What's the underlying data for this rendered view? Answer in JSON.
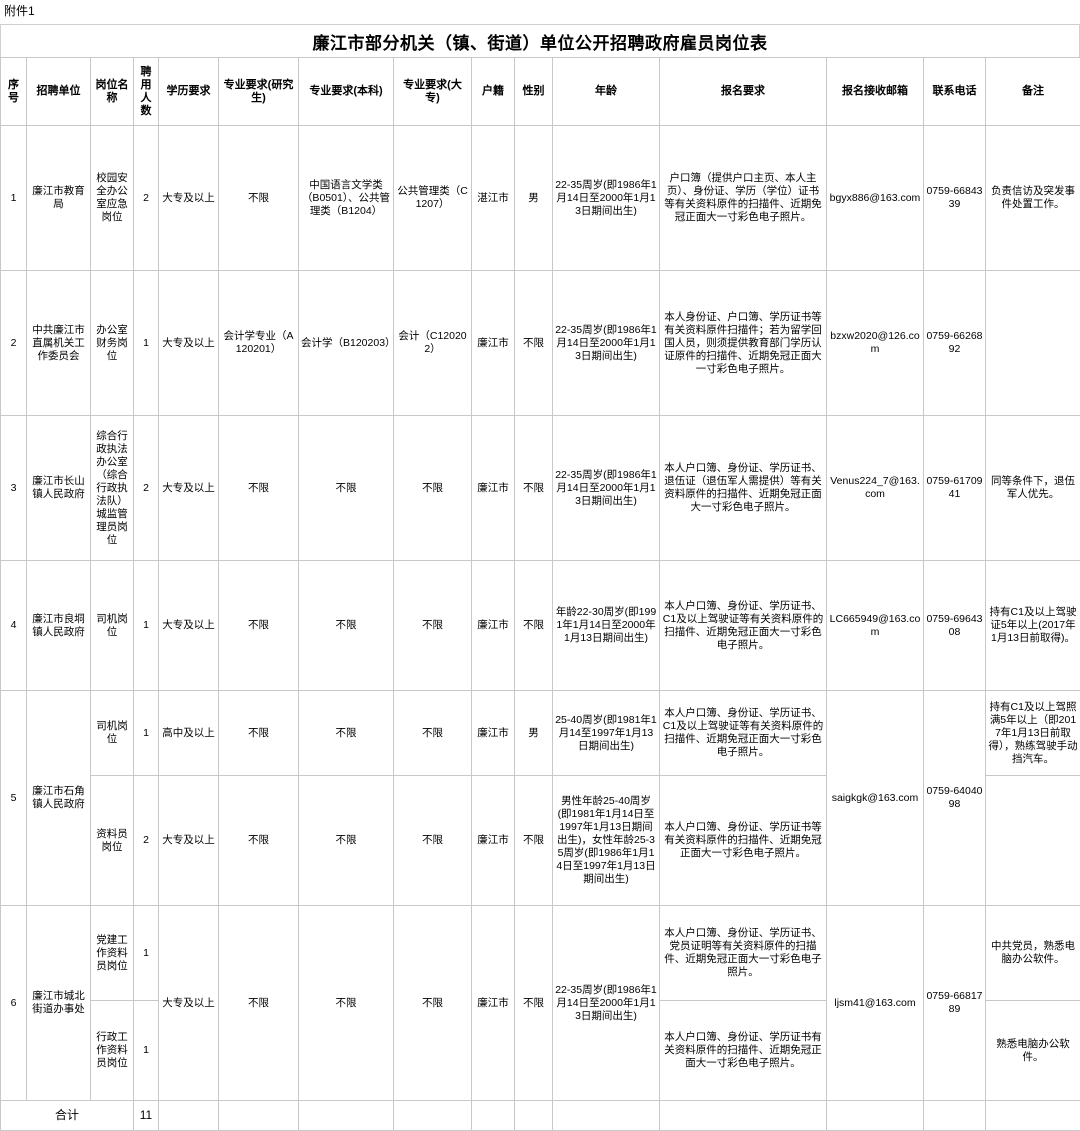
{
  "attachment_label": "附件1",
  "title": "廉江市部分机关（镇、街道）单位公开招聘政府雇员岗位表",
  "columns": {
    "idx": "序号",
    "unit": "招聘单位",
    "post": "岗位名称",
    "num": "聘用人数",
    "edu": "学历要求",
    "major_grad": "专业要求(研究生)",
    "major_bach": "专业要求(本科)",
    "major_assoc": "专业要求(大专)",
    "huji": "户籍",
    "sex": "性别",
    "age": "年龄",
    "req": "报名要求",
    "mail": "报名接收邮箱",
    "tel": "联系电话",
    "note": "备注"
  },
  "rows": [
    {
      "idx": "1",
      "unit": "廉江市教育局",
      "post": "校园安全办公室应急岗位",
      "num": "2",
      "edu": "大专及以上",
      "major_grad": "不限",
      "major_bach": "中国语言文学类（B0501）、公共管理类（B1204）",
      "major_assoc": "公共管理类（C1207）",
      "huji": "湛江市",
      "sex": "男",
      "age": "22-35周岁(即1986年1月14日至2000年1月13日期间出生)",
      "req": "户口簿（提供户口主页、本人主页）、身份证、学历（学位）证书等有关资料原件的扫描件、近期免冠正面大一寸彩色电子照片。",
      "mail": "bgyx886@163.com",
      "tel": "0759-6684339",
      "note": "负责信访及突发事件处置工作。"
    },
    {
      "idx": "2",
      "unit": "中共廉江市直属机关工作委员会",
      "post": "办公室财务岗位",
      "num": "1",
      "edu": "大专及以上",
      "major_grad": "会计学专业（A120201）",
      "major_bach": "会计学（B120203）",
      "major_assoc": "会计（C120202）",
      "huji": "廉江市",
      "sex": "不限",
      "age": "22-35周岁(即1986年1月14日至2000年1月13日期间出生)",
      "req": "本人身份证、户口簿、学历证书等有关资料原件扫描件；若为留学回国人员，则须提供教育部门学历认证原件的扫描件、近期免冠正面大一寸彩色电子照片。",
      "mail": "bzxw2020@126.com",
      "tel": "0759-6626892",
      "note": ""
    },
    {
      "idx": "3",
      "unit": "廉江市长山镇人民政府",
      "post": "综合行政执法办公室（综合行政执法队）城监管理员岗位",
      "num": "2",
      "edu": "大专及以上",
      "major_grad": "不限",
      "major_bach": "不限",
      "major_assoc": "不限",
      "huji": "廉江市",
      "sex": "不限",
      "age": "22-35周岁(即1986年1月14日至2000年1月13日期间出生)",
      "req": "本人户口簿、身份证、学历证书、退伍证（退伍军人需提供）等有关资料原件的扫描件、近期免冠正面大一寸彩色电子照片。",
      "mail": "Venus224_7@163.com",
      "tel": "0759-6170941",
      "note": "同等条件下，退伍军人优先。"
    },
    {
      "idx": "4",
      "unit": "廉江市良垌镇人民政府",
      "post": "司机岗位",
      "num": "1",
      "edu": "大专及以上",
      "major_grad": "不限",
      "major_bach": "不限",
      "major_assoc": "不限",
      "huji": "廉江市",
      "sex": "不限",
      "age": "年龄22-30周岁(即1991年1月14日至2000年1月13日期间出生)",
      "req": "本人户口簿、身份证、学历证书、C1及以上驾驶证等有关资料原件的扫描件、近期免冠正面大一寸彩色电子照片。",
      "mail": "LC665949@163.com",
      "tel": "0759-6964308",
      "note": "持有C1及以上驾驶证5年以上(2017年1月13日前取得)。"
    }
  ],
  "row5": {
    "idx": "5",
    "unit": "廉江市石角镇人民政府",
    "mail": "saigkgk@163.com",
    "tel": "0759-6404098",
    "sub": [
      {
        "post": "司机岗位",
        "num": "1",
        "edu": "高中及以上",
        "major_grad": "不限",
        "major_bach": "不限",
        "major_assoc": "不限",
        "huji": "廉江市",
        "sex": "男",
        "age": "25-40周岁(即1981年1月14至1997年1月13日期间出生)",
        "req": "本人户口簿、身份证、学历证书、C1及以上驾驶证等有关资料原件的扫描件、近期免冠正面大一寸彩色电子照片。",
        "note": "持有C1及以上驾照满5年以上（即2017年1月13日前取得），熟练驾驶手动挡汽车。"
      },
      {
        "post": "资料员岗位",
        "num": "2",
        "edu": "大专及以上",
        "major_grad": "不限",
        "major_bach": "不限",
        "major_assoc": "不限",
        "huji": "廉江市",
        "sex": "不限",
        "age": "男性年龄25-40周岁(即1981年1月14日至1997年1月13日期间出生)，女性年龄25-35周岁(即1986年1月14日至1997年1月13日期间出生)",
        "req": "本人户口簿、身份证、学历证书等有关资料原件的扫描件、近期免冠正面大一寸彩色电子照片。",
        "note": ""
      }
    ]
  },
  "row6": {
    "idx": "6",
    "unit": "廉江市城北街道办事处",
    "edu": "大专及以上",
    "major_grad": "不限",
    "major_bach": "不限",
    "major_assoc": "不限",
    "huji": "廉江市",
    "sex": "不限",
    "age": "22-35周岁(即1986年1月14日至2000年1月13日期间出生)",
    "mail": "ljsm41@163.com",
    "tel": "0759-6681789",
    "sub": [
      {
        "post": "党建工作资料员岗位",
        "num": "1",
        "req": "本人户口簿、身份证、学历证书、党员证明等有关资料原件的扫描件、近期免冠正面大一寸彩色电子照片。",
        "note": "中共党员，熟悉电脑办公软件。"
      },
      {
        "post": "行政工作资料员岗位",
        "num": "1",
        "req": "本人户口簿、身份证、学历证书有关资料原件的扫描件、近期免冠正面大一寸彩色电子照片。",
        "note": "熟悉电脑办公软件。"
      }
    ]
  },
  "total": {
    "label": "合计",
    "count": "11"
  }
}
